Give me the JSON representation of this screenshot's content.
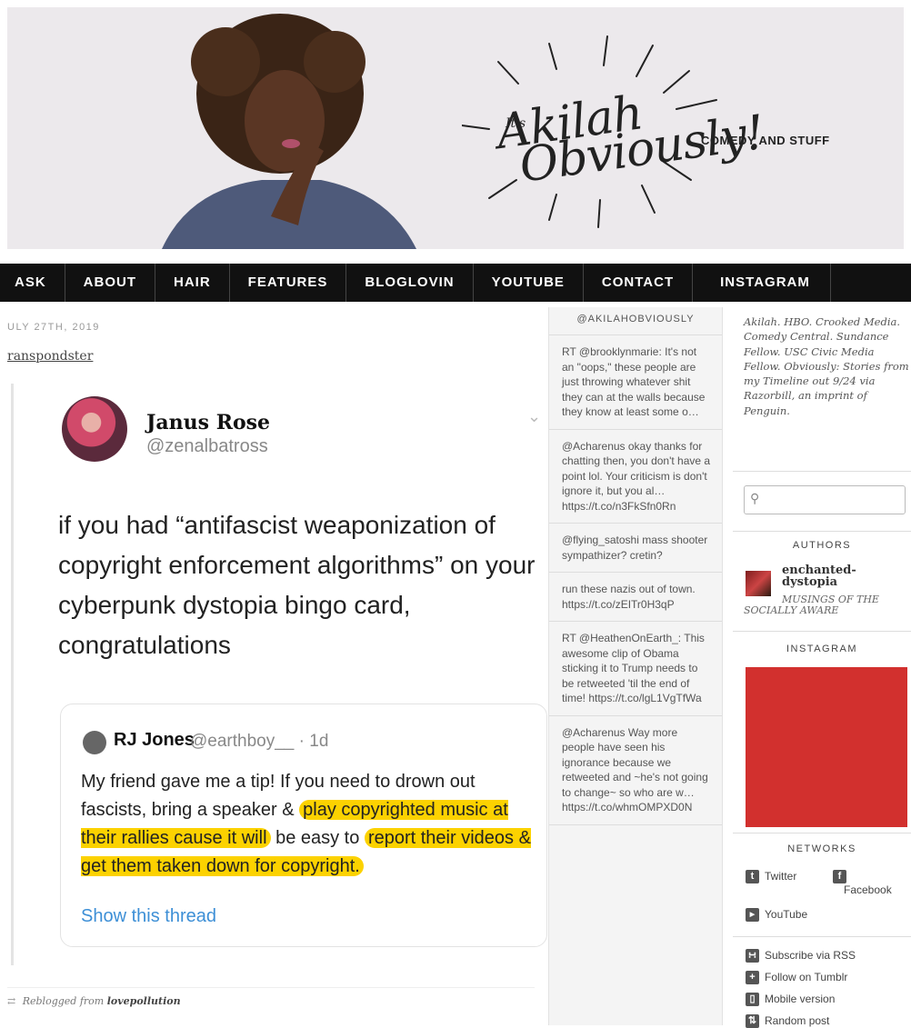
{
  "header": {
    "logo_its": "It's",
    "logo_line1": "Akilah",
    "logo_line2": "Obviously!",
    "tagline": "COMEDY AND STUFF"
  },
  "nav": [
    "ASK",
    "ABOUT",
    "HAIR",
    "FEATURES",
    "BLOGLOVIN",
    "YOUTUBE",
    "CONTACT",
    "INSTAGRAM"
  ],
  "post": {
    "date": "ULY 27TH, 2019",
    "source": "ranspondster",
    "tweet": {
      "name": "Janus Rose",
      "handle": "@zenalbatross",
      "text": "if you had “antifascist weaponization of copyright enforcement algorithms” on your cyberpunk dystopia bingo card, congratulations",
      "quoted": {
        "name": "RJ Jones",
        "handle_time": "@earthboy__ · 1d",
        "text_a": "My friend gave me a tip! If you need to drown out fascists, bring a speaker &",
        "text_hl1": "play copyrighted music at their rallies cause it will",
        "text_b": "be easy to",
        "text_hl2": "report their videos & get them taken down for copyright.",
        "show_thread": "Show this thread"
      }
    },
    "reblog_prefix": "Reblogged from",
    "reblog_from": "lovepollution"
  },
  "twitter_feed": {
    "header": "@AKILAHOBVIOUSLY",
    "items": [
      "RT @brooklynmarie: It's not an \"oops,\" these people are just throwing whatever shit they can at the walls because they know at least some o…",
      "@Acharenus okay thanks for chatting then, you don't have a point lol. Your criticism is don't ignore it, but you al… https://t.co/n3FkSfn0Rn",
      "@flying_satoshi mass shooter sympathizer? cretin?",
      "run these nazis out of town. https://t.co/zEITr0H3qP",
      "RT @HeathenOnEarth_: This awesome clip of Obama sticking it to Trump needs to be retweeted 'til the end of time! https://t.co/lgL1VgTfWa",
      "@Acharenus Way more people have seen his ignorance because we retweeted and ~he's not going to change~ so who are w… https://t.co/whmOMPXD0N"
    ]
  },
  "sidebar": {
    "description": "Akilah. HBO. Crooked Media. Comedy Central. Sundance Fellow. USC Civic Media Fellow. Obviously: Stories from my Timeline out 9/24 via Razorbill, an imprint of Penguin.",
    "search_placeholder": "",
    "authors_heading": "AUTHORS",
    "author_name_1": "enchanted-",
    "author_name_2": "dystopia",
    "author_sub_1": "MUSINGS OF THE",
    "author_sub_2": "SOCIALLY AWARE",
    "instagram_heading": "INSTAGRAM",
    "networks_heading": "NETWORKS",
    "networks": {
      "twitter": "Twitter",
      "facebook": "Facebook",
      "youtube": "YouTube"
    },
    "links": {
      "rss": "Subscribe via RSS",
      "follow": "Follow on Tumblr",
      "mobile": "Mobile version",
      "random": "Random post"
    }
  },
  "colors": {
    "highlight": "#fcd200",
    "link_blue": "#3d8fd6",
    "nav_bg": "#111111",
    "instagram_tile": "#d2302e"
  }
}
